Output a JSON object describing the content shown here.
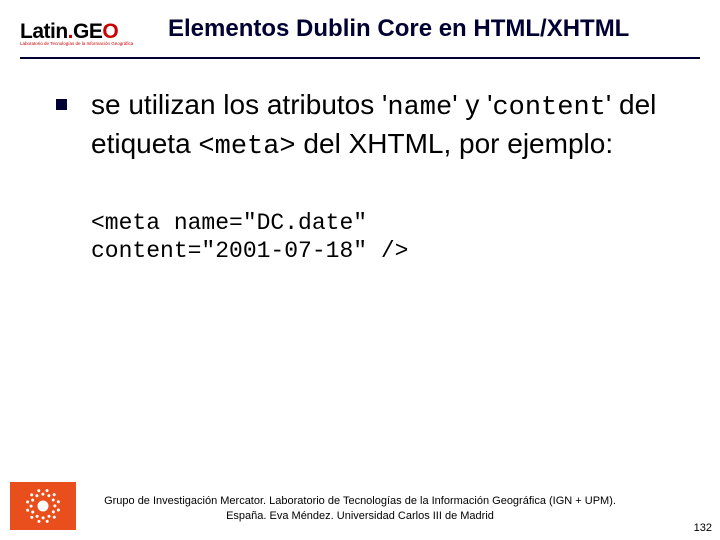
{
  "logo": {
    "brand_prefix": "Latin",
    "brand_dot": ".",
    "brand_suffix": "GE",
    "brand_last": "O",
    "tagline": "Laboratorio de Tecnologías de la Información Geográfica"
  },
  "title": "Elementos Dublin Core en HTML/XHTML",
  "body": {
    "part1": "se utilizan los atributos '",
    "code1": "name",
    "part2": "' y '",
    "code2": "content",
    "part3": "' del etiqueta ",
    "code3": "<meta>",
    "part4": " del XHTML, por ejemplo:"
  },
  "code": {
    "line1": "<meta name=\"DC.date\"",
    "line2": "content=\"2001-07-18\" />"
  },
  "footer": {
    "line1": "Grupo de Investigación Mercator. Laboratorio de Tecnologías de la Información Geográfica (IGN + UPM).",
    "line2": "España. Eva Méndez. Universidad Carlos III de Madrid"
  },
  "page_number": "132"
}
